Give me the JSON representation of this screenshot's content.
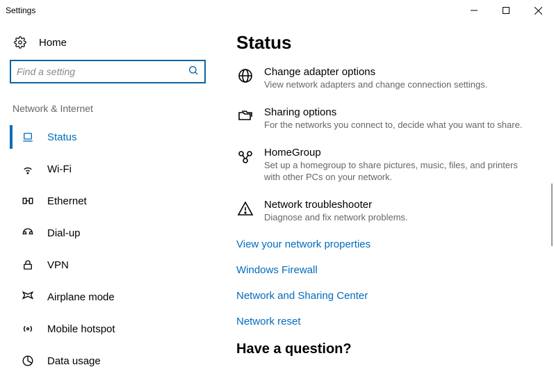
{
  "window": {
    "title": "Settings"
  },
  "sidebar": {
    "home": "Home",
    "search_placeholder": "Find a setting",
    "section": "Network & Internet",
    "items": [
      {
        "label": "Status"
      },
      {
        "label": "Wi-Fi"
      },
      {
        "label": "Ethernet"
      },
      {
        "label": "Dial-up"
      },
      {
        "label": "VPN"
      },
      {
        "label": "Airplane mode"
      },
      {
        "label": "Mobile hotspot"
      },
      {
        "label": "Data usage"
      }
    ]
  },
  "content": {
    "title": "Status",
    "options": [
      {
        "title": "Change adapter options",
        "desc": "View network adapters and change connection settings."
      },
      {
        "title": "Sharing options",
        "desc": "For the networks you connect to, decide what you want to share."
      },
      {
        "title": "HomeGroup",
        "desc": "Set up a homegroup to share pictures, music, files, and printers with other PCs on your network."
      },
      {
        "title": "Network troubleshooter",
        "desc": "Diagnose and fix network problems."
      }
    ],
    "links": [
      "View your network properties",
      "Windows Firewall",
      "Network and Sharing Center",
      "Network reset"
    ],
    "question": "Have a question?"
  }
}
